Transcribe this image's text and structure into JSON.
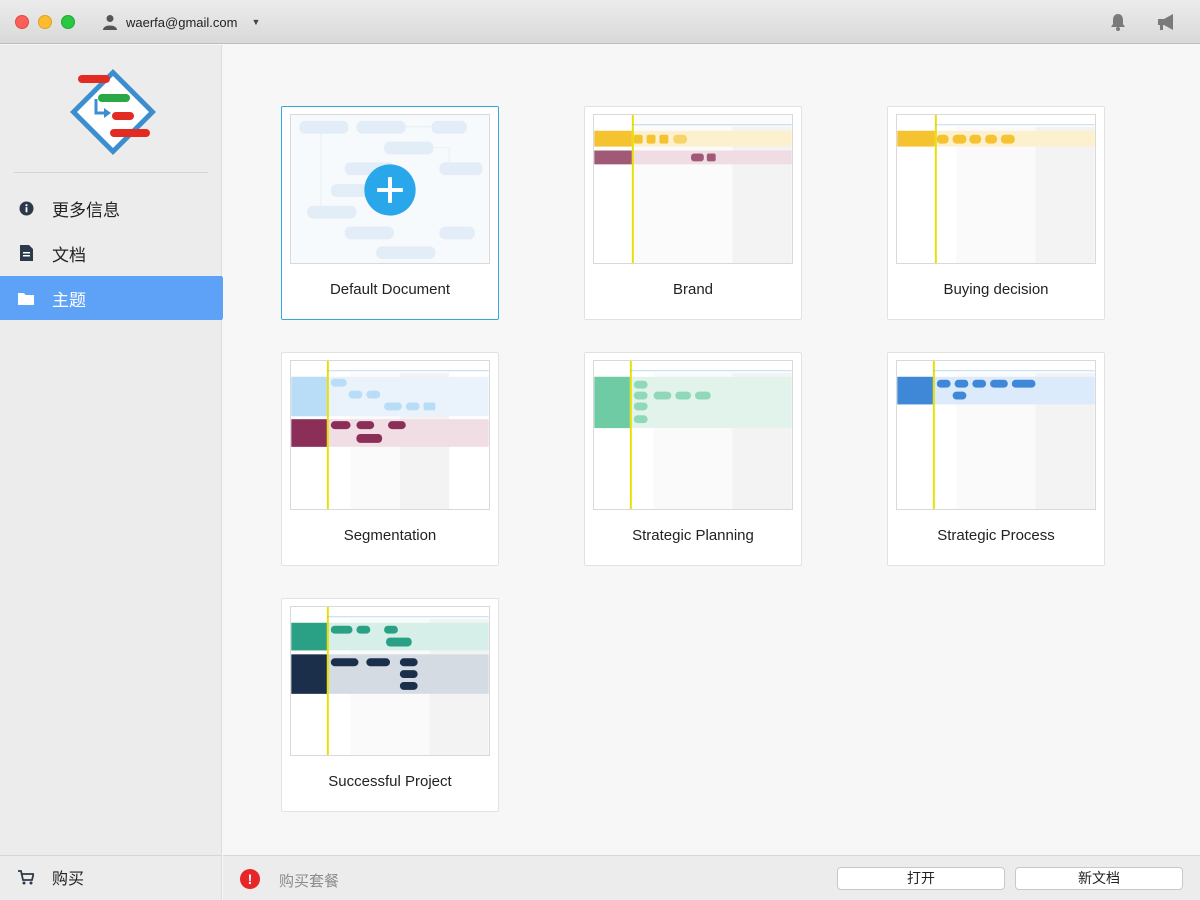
{
  "account": {
    "email": "waerfa@gmail.com"
  },
  "sidebar": {
    "items": [
      {
        "label": "更多信息",
        "icon": "info-icon"
      },
      {
        "label": "文档",
        "icon": "document-icon"
      },
      {
        "label": "主题",
        "icon": "folder-icon",
        "selected": true
      }
    ],
    "buy_label": "购买"
  },
  "templates": [
    {
      "label": "Default Document",
      "selected": true
    },
    {
      "label": "Brand"
    },
    {
      "label": "Buying decision"
    },
    {
      "label": "Segmentation"
    },
    {
      "label": "Strategic Planning"
    },
    {
      "label": "Strategic Process"
    },
    {
      "label": "Successful Project"
    }
  ],
  "footer": {
    "buy_plan_label": "购买套餐",
    "open_label": "打开",
    "new_doc_label": "新文档"
  },
  "colors": {
    "accent": "#5ea2f7",
    "selected_border": "#35a8d9",
    "add_button": "#2aa6ea",
    "warning": "#e8262a"
  }
}
